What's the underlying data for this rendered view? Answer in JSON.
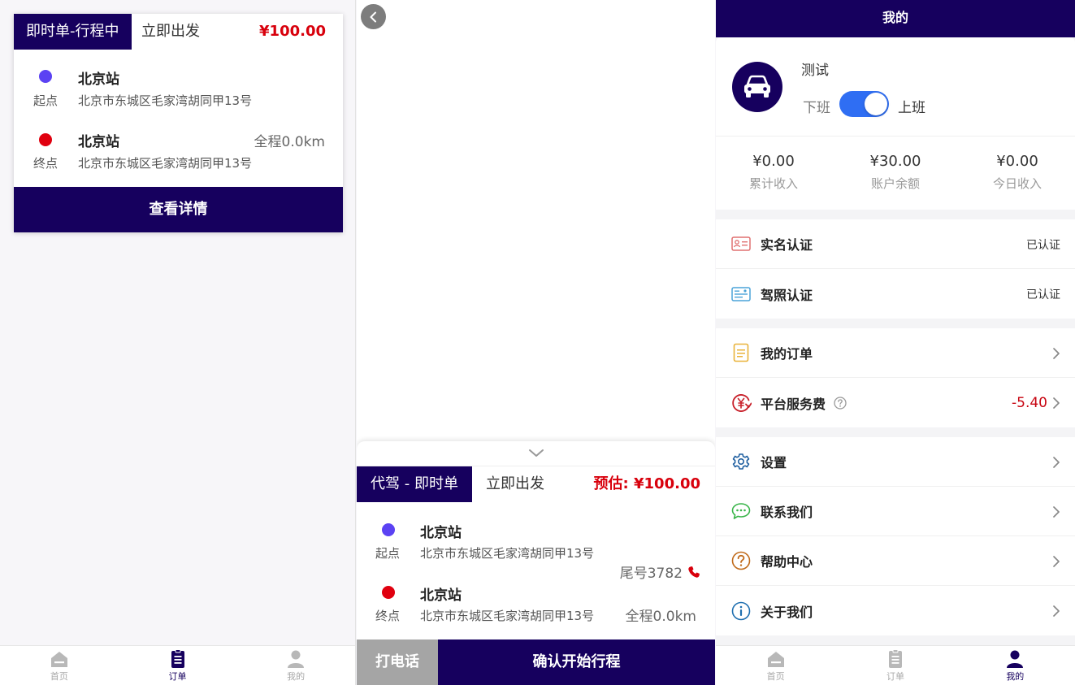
{
  "orders_page": {
    "order": {
      "tag": "即时单-行程中",
      "departure": "立即出发",
      "price": "¥100.00",
      "start_label": "起点",
      "start_station": "北京站",
      "start_address": "北京市东城区毛家湾胡同甲13号",
      "end_label": "终点",
      "end_station": "北京站",
      "end_address": "北京市东城区毛家湾胡同甲13号",
      "distance": "全程0.0km",
      "detail_button": "查看详情"
    }
  },
  "trip_page": {
    "tag": "代驾 - 即时单",
    "departure": "立即出发",
    "estimate": "预估: ¥100.00",
    "start_label": "起点",
    "start_station": "北京站",
    "start_address": "北京市东城区毛家湾胡同甲13号",
    "phone_tail": "尾号3782",
    "end_label": "终点",
    "end_station": "北京站",
    "end_address": "北京市东城区毛家湾胡同甲13号",
    "distance": "全程0.0km",
    "call_button": "打电话",
    "start_button": "确认开始行程"
  },
  "profile_page": {
    "header_title": "我的",
    "user_name": "测试",
    "off_duty": "下班",
    "on_duty": "上班",
    "duty_on": true,
    "stats": [
      {
        "value": "¥0.00",
        "label": "累计收入"
      },
      {
        "value": "¥30.00",
        "label": "账户余额"
      },
      {
        "value": "¥0.00",
        "label": "今日收入"
      }
    ],
    "verify_items": [
      {
        "label": "实名认证",
        "status": "已认证",
        "icon": "id-card-icon"
      },
      {
        "label": "驾照认证",
        "status": "已认证",
        "icon": "license-icon"
      }
    ],
    "account_items": [
      {
        "label": "我的订单",
        "icon": "order-list-icon"
      },
      {
        "label": "平台服务费",
        "value": "-5.40",
        "icon": "service-fee-icon"
      }
    ],
    "misc_items": [
      {
        "label": "设置",
        "icon": "gear-icon"
      },
      {
        "label": "联系我们",
        "icon": "chat-icon"
      },
      {
        "label": "帮助中心",
        "icon": "help-icon"
      },
      {
        "label": "关于我们",
        "icon": "info-icon"
      }
    ]
  },
  "tabbar": [
    {
      "label": "首页",
      "icon": "home-icon"
    },
    {
      "label": "订单",
      "icon": "order-icon"
    },
    {
      "label": "我的",
      "icon": "user-icon"
    }
  ],
  "colors": {
    "brand": "#16005e",
    "price_red": "#d8000c",
    "start_dot": "#5b42f3",
    "end_dot": "#e0000f",
    "toggle_blue": "#2f6ef3"
  }
}
